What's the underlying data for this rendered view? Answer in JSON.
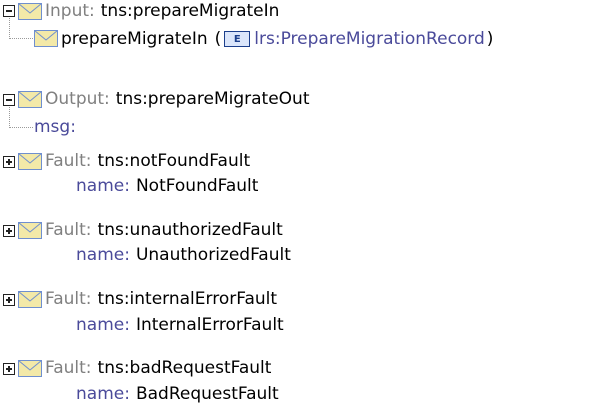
{
  "input": {
    "label": "Input:",
    "value": "tns:prepareMigrateIn",
    "part_name": "prepareMigrateIn",
    "open_paren": "(",
    "badge": "E",
    "part_type": "lrs:PrepareMigrationRecord",
    "close_paren": ")"
  },
  "output": {
    "label": "Output:",
    "value": "tns:prepareMigrateOut",
    "part_name": "msg:"
  },
  "faults": [
    {
      "label": "Fault:",
      "value": "tns:notFoundFault",
      "name_label": "name:",
      "name_value": "NotFoundFault"
    },
    {
      "label": "Fault:",
      "value": "tns:unauthorizedFault",
      "name_label": "name:",
      "name_value": "UnauthorizedFault"
    },
    {
      "label": "Fault:",
      "value": "tns:internalErrorFault",
      "name_label": "name:",
      "name_value": "InternalErrorFault"
    },
    {
      "label": "Fault:",
      "value": "tns:badRequestFault",
      "name_label": "name:",
      "name_value": "BadRequestFault"
    }
  ],
  "colors": {
    "label_gray": "#808080",
    "name_blue": "#4a4a9a",
    "envelope_fill": "#f3e9a8",
    "envelope_stroke": "#6f8fcf"
  }
}
